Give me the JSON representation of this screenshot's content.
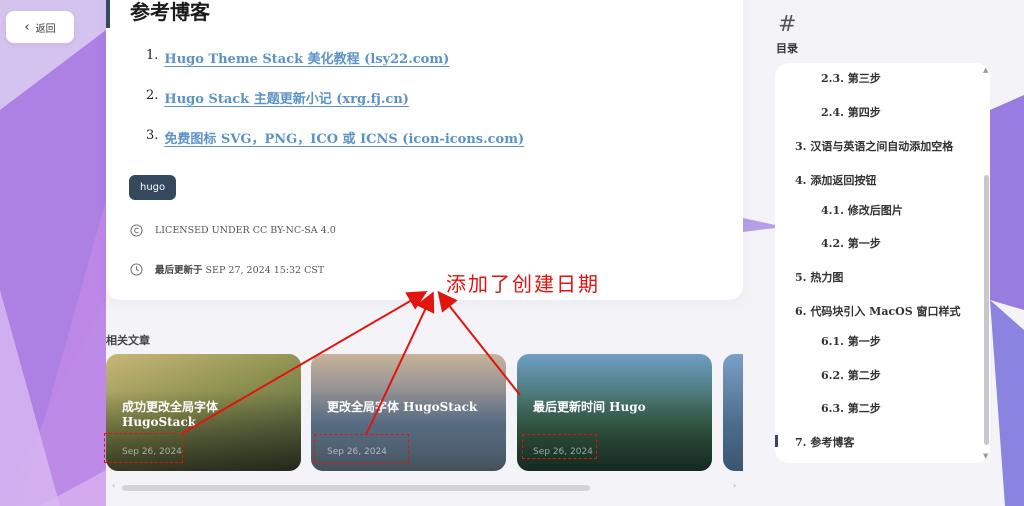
{
  "nav": {
    "back_label": "返回"
  },
  "article": {
    "title": "参考博客",
    "references": [
      {
        "num": "1.",
        "text": "Hugo Theme Stack 美化教程 (lsy22.com)"
      },
      {
        "num": "2.",
        "text": "Hugo Stack 主题更新小记 (xrg.fj.cn)"
      },
      {
        "num": "3.",
        "text": "免费图标 SVG，PNG，ICO 或 ICNS (icon-icons.com)"
      }
    ],
    "tag": "hugo",
    "license": "LICENSED UNDER CC BY-NC-SA 4.0",
    "last_updated_label": "最后更新于",
    "last_updated_value": "SEP 27, 2024 15:32 CST"
  },
  "annotation": {
    "text": "添加了创建日期",
    "color": "#e3130f"
  },
  "related": {
    "title": "相关文章",
    "cards": [
      {
        "title": "成功更改全局字体 HugoStack",
        "date": "Sep 26, 2024"
      },
      {
        "title": "更改全局字体 HugoStack",
        "date": "Sep 26, 2024"
      },
      {
        "title": "最后更新时间 Hugo",
        "date": "Sep 26, 2024"
      }
    ]
  },
  "toc": {
    "icon": "#",
    "label": "目录",
    "items": [
      {
        "text": "2.3.  第三步"
      },
      {
        "text": "2.4.  第四步"
      },
      {
        "text": "3.  汉语与英语之间自动添加空格"
      },
      {
        "text": "4.  添加返回按钮"
      },
      {
        "text": "4.1.  修改后图片"
      },
      {
        "text": "4.2.  第一步"
      },
      {
        "text": "5.  热力图"
      },
      {
        "text": "6.  代码块引入 MacOS 窗口样式"
      },
      {
        "text": "6.1.  第一步"
      },
      {
        "text": "6.2.  第二步"
      },
      {
        "text": "6.3.  第二步"
      },
      {
        "text": "7.  参考博客"
      }
    ]
  },
  "colors": {
    "accent": "#34495e",
    "link": "#5c93c7",
    "annotation": "#e3130f"
  }
}
